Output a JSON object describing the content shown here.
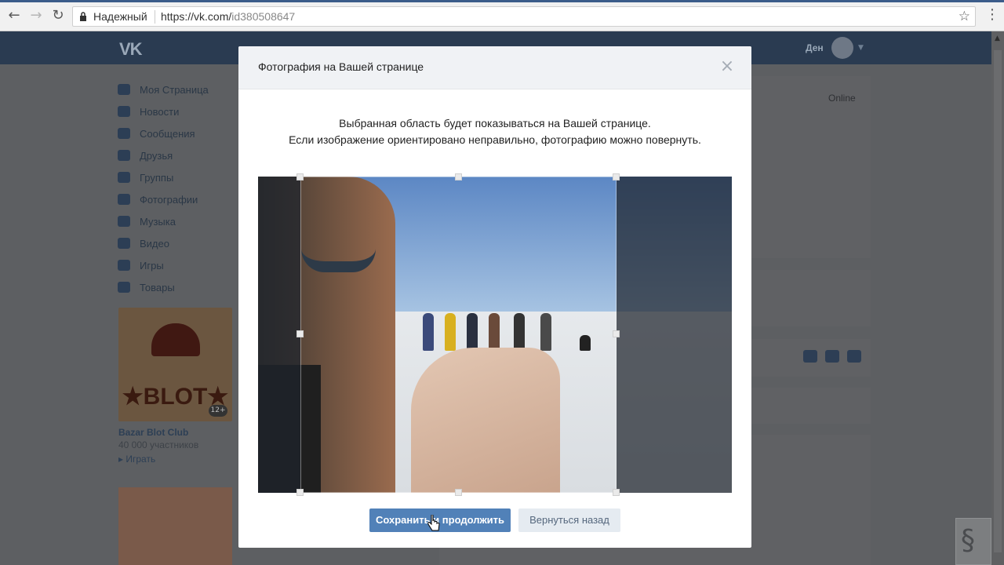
{
  "browser": {
    "secure_label": "Надежный",
    "url_host": "https://vk.com/",
    "url_path": "id380508647"
  },
  "header": {
    "user_name": "Ден"
  },
  "left_menu": {
    "items": [
      {
        "label": "Моя Страница"
      },
      {
        "label": "Новости"
      },
      {
        "label": "Сообщения"
      },
      {
        "label": "Друзья"
      },
      {
        "label": "Группы"
      },
      {
        "label": "Фотографии"
      },
      {
        "label": "Музыка"
      },
      {
        "label": "Видео"
      },
      {
        "label": "Игры"
      },
      {
        "label": "Товары"
      }
    ]
  },
  "promo": {
    "logo_text": "★BLOT★",
    "age": "12+",
    "title": "Bazar Blot Club",
    "members": "40 000 участников",
    "play": "▸ Играть"
  },
  "profile": {
    "status": "Online"
  },
  "modal": {
    "title": "Фотография на Вашей странице",
    "desc_line1": "Выбранная область будет показываться на Вашей странице.",
    "desc_line2": "Если изображение ориентировано неправильно, фотографию можно повернуть.",
    "save_button": "Сохранить и продолжить",
    "back_button": "Вернуться назад"
  },
  "colors": {
    "accent": "#5181b8",
    "header_bg": "#f0f2f5"
  }
}
